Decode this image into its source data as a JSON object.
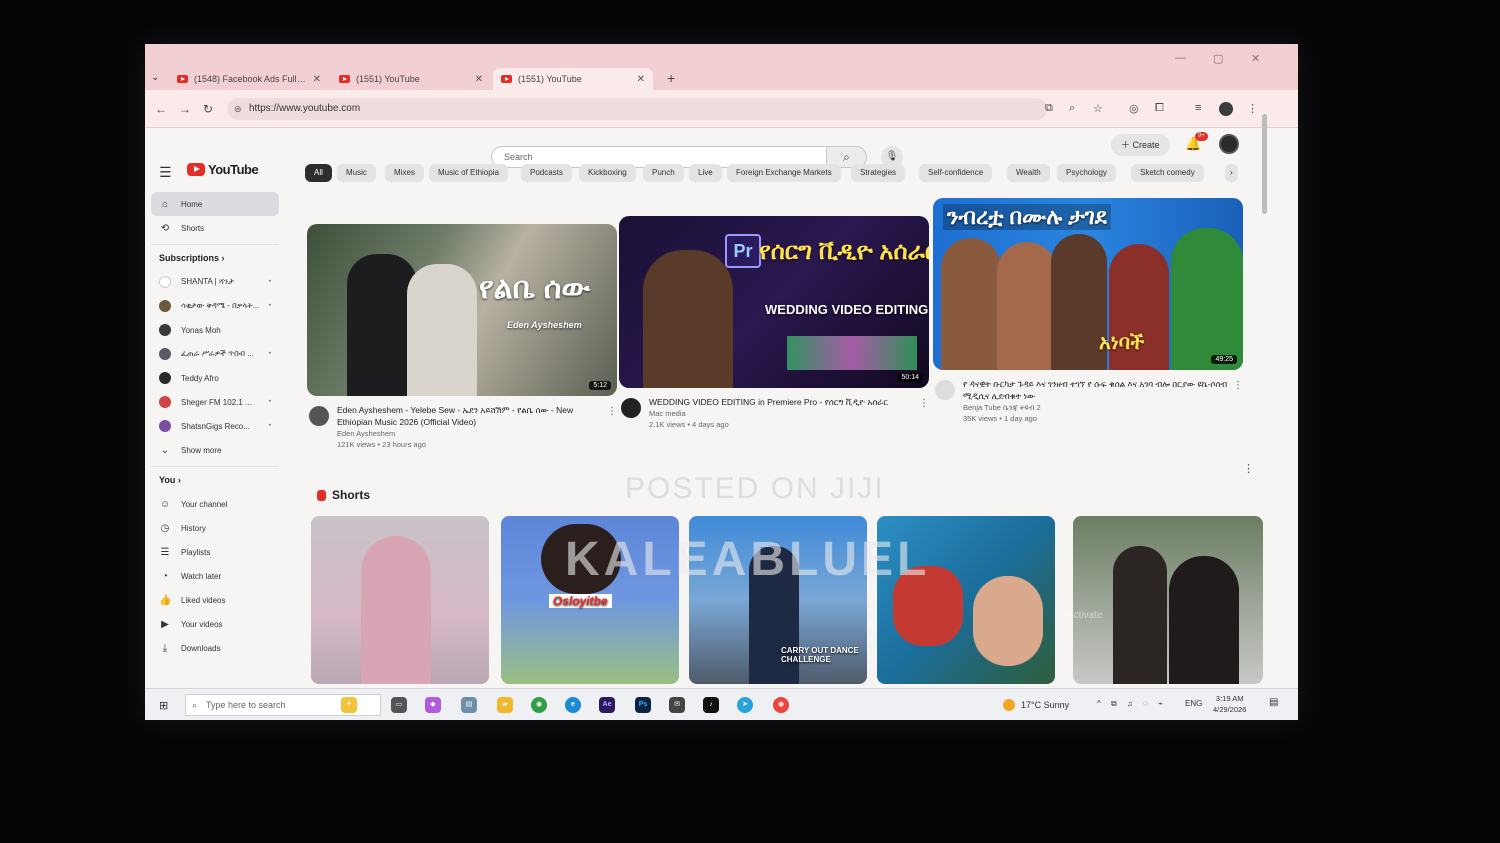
{
  "tabs": [
    {
      "label": "(1548) Facebook Ads Full Cours"
    },
    {
      "label": "(1551) YouTube"
    },
    {
      "label": "(1551) YouTube"
    }
  ],
  "address": {
    "url": "https://www.youtube.com"
  },
  "header": {
    "logo": "YouTube",
    "search_placeholder": "Search",
    "create_label": "Create",
    "notification_count": "9+"
  },
  "sidebar": {
    "main": [
      {
        "label": "Home",
        "icon": "home-icon"
      },
      {
        "label": "Shorts",
        "icon": "shorts-icon"
      }
    ],
    "subscriptions_title": "Subscriptions",
    "subscriptions": [
      {
        "label": "SHANTA | ሻንታ",
        "color": "#ffffff"
      },
      {
        "label": "ሳቂታው ቅዳሜ - በቃላት...",
        "color": "#6b5a3c"
      },
      {
        "label": "Yonas Moh",
        "color": "#3a3a3a"
      },
      {
        "label": "ፈጠራ ሥራዎች ጥበብ ...",
        "color": "#5a5a66"
      },
      {
        "label": "Teddy Afro",
        "color": "#2a2a2a"
      },
      {
        "label": "Sheger FM 102.1 ...",
        "color": "#c44"
      },
      {
        "label": "ShatsnGigs Reco...",
        "color": "#7a4da0"
      }
    ],
    "show_more": "Show more",
    "you_title": "You",
    "you": [
      {
        "label": "Your channel",
        "icon": "channel-icon"
      },
      {
        "label": "History",
        "icon": "history-icon"
      },
      {
        "label": "Playlists",
        "icon": "playlist-icon"
      },
      {
        "label": "Watch later",
        "icon": "watch-later-icon"
      },
      {
        "label": "Liked videos",
        "icon": "like-icon"
      },
      {
        "label": "Your videos",
        "icon": "your-videos-icon"
      },
      {
        "label": "Downloads",
        "icon": "download-icon"
      }
    ]
  },
  "chips": [
    "All",
    "Music",
    "Mixes",
    "Music of Ethiopia",
    "Podcasts",
    "Kickboxing",
    "Punch",
    "Live",
    "Foreign Exchange Markets",
    "Strategies",
    "Self-confidence",
    "Wealth",
    "Psychology",
    "Sketch comedy"
  ],
  "videos": [
    {
      "title": "Eden Aysheshem - Yelebe Sew - ኤደን አይሸሽም - የልቤ ሰው - New Ethiopian Music 2026 (Official Video)",
      "channel": "Eden Aysheshem",
      "stats": "121K views • 23 hours ago",
      "duration": "5:12",
      "thumb_text": "የልቤ ሰው",
      "thumb_sub": "Eden Aysheshem"
    },
    {
      "title": "WEDDING VIDEO EDITING in Premiere Pro - የሰርግ ቪዲዮ አሰራር",
      "channel": "Mac media",
      "stats": "2.1K views • 4 days ago",
      "duration": "50:14",
      "thumb_text": "የሰርግ ቪዲዮ አሰራር",
      "thumb_sub": "WEDDING VIDEO EDITING"
    },
    {
      "title": "የ ዳናዊት ቡርካታ ጉዳይ እና ገንዘብ ተገኘ የ ሱፍ ቁሰል እና አገባ ብሎ በርያው ዩኬ-ሶሰብ ሚዲሲና ሊደብቁት ነው",
      "channel": "Benja Tube ቤንጃ ትዩብ 2",
      "stats": "35K views • 1 day ago",
      "duration": "49:25",
      "thumb_text": "ንብረቷ በሙሉ ታገደ",
      "thumb_sub": "አነባች"
    }
  ],
  "shorts": {
    "title": "Shorts",
    "items": [
      {
        "text": ""
      },
      {
        "text": "Osloyitbe"
      },
      {
        "text": "CARRY OUT DANCE CHALLENGE"
      },
      {
        "text": ""
      },
      {
        "text": ""
      }
    ]
  },
  "taskbar": {
    "search_placeholder": "Type here to search",
    "weather": "17°C  Sunny",
    "lang": "ENG",
    "time": "3:19 AM",
    "date": "4/29/2026"
  },
  "watermarks": {
    "posted": "POSTED ON JIJI",
    "user": "KALEABLUEL",
    "activate": "Activate"
  }
}
